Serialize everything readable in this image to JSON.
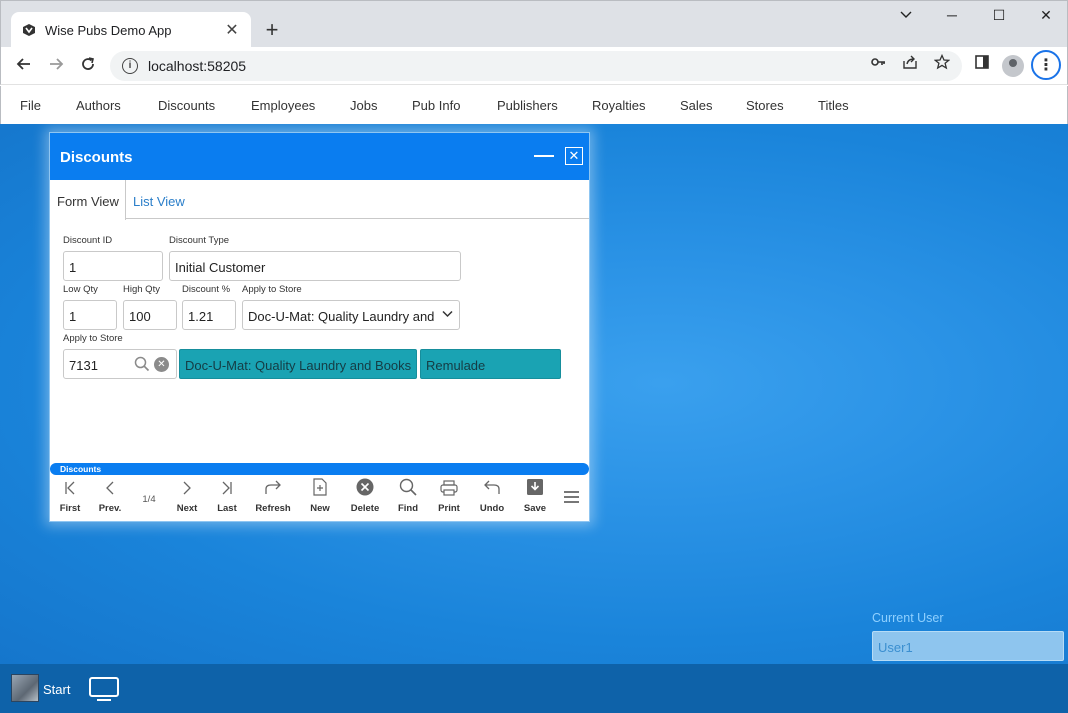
{
  "browser": {
    "tab_title": "Wise Pubs Demo App",
    "tab_close": "✕",
    "new_tab": "+",
    "url": "localhost:58205",
    "window_controls": {
      "minimize": "─",
      "restore": "☐",
      "close": "✕"
    }
  },
  "menu": {
    "items": [
      "File",
      "Authors",
      "Discounts",
      "Employees",
      "Jobs",
      "Pub Info",
      "Publishers",
      "Royalties",
      "Sales",
      "Stores",
      "Titles"
    ]
  },
  "window": {
    "title": "Discounts",
    "tabs": {
      "form": "Form View",
      "list": "List View"
    },
    "fields": {
      "discount_id": {
        "label": "Discount ID",
        "value": "1"
      },
      "discount_type": {
        "label": "Discount Type",
        "value": "Initial Customer"
      },
      "low_qty": {
        "label": "Low Qty",
        "value": "1"
      },
      "high_qty": {
        "label": "High Qty",
        "value": "100"
      },
      "discount_pct": {
        "label": "Discount %",
        "value": "1.21"
      },
      "apply_store_select": {
        "label": "Apply to Store",
        "value": "Doc-U-Mat: Quality Laundry and"
      },
      "apply_store_lookup": {
        "label": "Apply to Store",
        "value": "7131",
        "name": "Doc-U-Mat: Quality Laundry and Books",
        "city": "Remulade"
      }
    },
    "status_label": "Discounts",
    "pager": "1/4",
    "toolbar": {
      "first": "First",
      "prev": "Prev.",
      "next": "Next",
      "last": "Last",
      "refresh": "Refresh",
      "new": "New",
      "delete": "Delete",
      "find": "Find",
      "print": "Print",
      "undo": "Undo",
      "save": "Save"
    }
  },
  "current_user": {
    "label": "Current User",
    "value": "User1"
  },
  "taskbar": {
    "start": "Start"
  },
  "colors": {
    "accent": "#0a7df0",
    "teal": "#1aa3b3",
    "taskbar": "#0e62a9"
  }
}
